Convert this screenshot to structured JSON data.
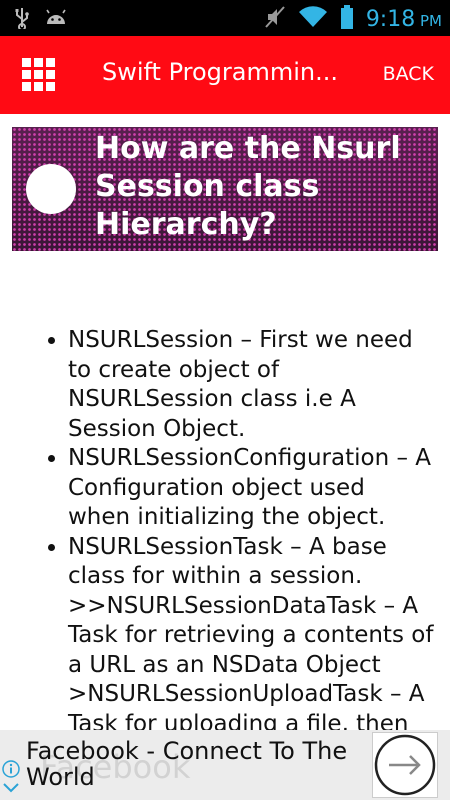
{
  "status_bar": {
    "time": "9:18",
    "ampm": "PM",
    "icons": [
      "usb-icon",
      "android-icon",
      "mute-icon",
      "wifi-icon",
      "battery-icon"
    ]
  },
  "app_bar": {
    "title": "Swift Programmin...",
    "back_label": "BACK",
    "color": "#ff0a14"
  },
  "banner": {
    "title": "How are the Nsurl Session class Hierarchy?"
  },
  "content": {
    "items": [
      {
        "text": "NSURLSession – First we need to create object of NSURLSession class i.e A Session Object."
      },
      {
        "text": "NSURLSessionConfiguration – A Configuration object used when initializing the object."
      },
      {
        "text": "NSURLSessionTask – A base class for within a session. >>NSURLSessionDataTask – A Task for retrieving a contents of a URL as an NSData Object >NSURLSessionUploadTask – A Task for uploading a file, then"
      }
    ]
  },
  "ad": {
    "text": "Facebook - Connect To The World",
    "watermark": "Facebook"
  }
}
